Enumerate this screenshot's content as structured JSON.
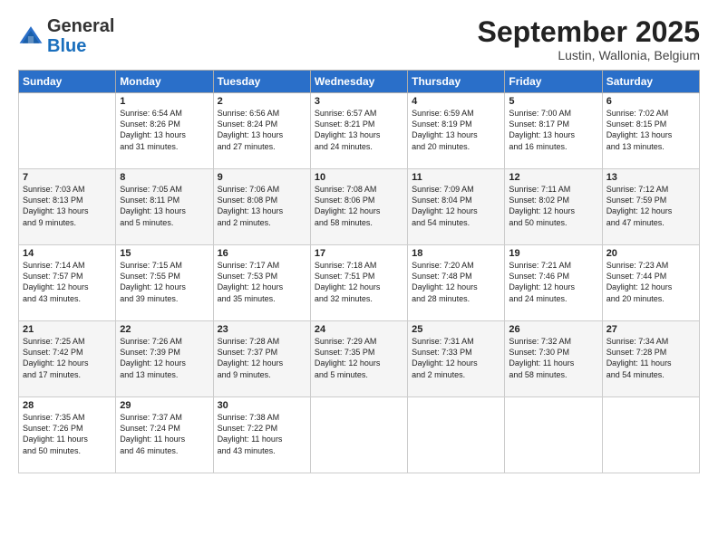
{
  "header": {
    "logo": {
      "general": "General",
      "blue": "Blue"
    },
    "month_title": "September 2025",
    "location": "Lustin, Wallonia, Belgium"
  },
  "days_of_week": [
    "Sunday",
    "Monday",
    "Tuesday",
    "Wednesday",
    "Thursday",
    "Friday",
    "Saturday"
  ],
  "weeks": [
    [
      {
        "day": "",
        "info": ""
      },
      {
        "day": "1",
        "info": "Sunrise: 6:54 AM\nSunset: 8:26 PM\nDaylight: 13 hours\nand 31 minutes."
      },
      {
        "day": "2",
        "info": "Sunrise: 6:56 AM\nSunset: 8:24 PM\nDaylight: 13 hours\nand 27 minutes."
      },
      {
        "day": "3",
        "info": "Sunrise: 6:57 AM\nSunset: 8:21 PM\nDaylight: 13 hours\nand 24 minutes."
      },
      {
        "day": "4",
        "info": "Sunrise: 6:59 AM\nSunset: 8:19 PM\nDaylight: 13 hours\nand 20 minutes."
      },
      {
        "day": "5",
        "info": "Sunrise: 7:00 AM\nSunset: 8:17 PM\nDaylight: 13 hours\nand 16 minutes."
      },
      {
        "day": "6",
        "info": "Sunrise: 7:02 AM\nSunset: 8:15 PM\nDaylight: 13 hours\nand 13 minutes."
      }
    ],
    [
      {
        "day": "7",
        "info": "Sunrise: 7:03 AM\nSunset: 8:13 PM\nDaylight: 13 hours\nand 9 minutes."
      },
      {
        "day": "8",
        "info": "Sunrise: 7:05 AM\nSunset: 8:11 PM\nDaylight: 13 hours\nand 5 minutes."
      },
      {
        "day": "9",
        "info": "Sunrise: 7:06 AM\nSunset: 8:08 PM\nDaylight: 13 hours\nand 2 minutes."
      },
      {
        "day": "10",
        "info": "Sunrise: 7:08 AM\nSunset: 8:06 PM\nDaylight: 12 hours\nand 58 minutes."
      },
      {
        "day": "11",
        "info": "Sunrise: 7:09 AM\nSunset: 8:04 PM\nDaylight: 12 hours\nand 54 minutes."
      },
      {
        "day": "12",
        "info": "Sunrise: 7:11 AM\nSunset: 8:02 PM\nDaylight: 12 hours\nand 50 minutes."
      },
      {
        "day": "13",
        "info": "Sunrise: 7:12 AM\nSunset: 7:59 PM\nDaylight: 12 hours\nand 47 minutes."
      }
    ],
    [
      {
        "day": "14",
        "info": "Sunrise: 7:14 AM\nSunset: 7:57 PM\nDaylight: 12 hours\nand 43 minutes."
      },
      {
        "day": "15",
        "info": "Sunrise: 7:15 AM\nSunset: 7:55 PM\nDaylight: 12 hours\nand 39 minutes."
      },
      {
        "day": "16",
        "info": "Sunrise: 7:17 AM\nSunset: 7:53 PM\nDaylight: 12 hours\nand 35 minutes."
      },
      {
        "day": "17",
        "info": "Sunrise: 7:18 AM\nSunset: 7:51 PM\nDaylight: 12 hours\nand 32 minutes."
      },
      {
        "day": "18",
        "info": "Sunrise: 7:20 AM\nSunset: 7:48 PM\nDaylight: 12 hours\nand 28 minutes."
      },
      {
        "day": "19",
        "info": "Sunrise: 7:21 AM\nSunset: 7:46 PM\nDaylight: 12 hours\nand 24 minutes."
      },
      {
        "day": "20",
        "info": "Sunrise: 7:23 AM\nSunset: 7:44 PM\nDaylight: 12 hours\nand 20 minutes."
      }
    ],
    [
      {
        "day": "21",
        "info": "Sunrise: 7:25 AM\nSunset: 7:42 PM\nDaylight: 12 hours\nand 17 minutes."
      },
      {
        "day": "22",
        "info": "Sunrise: 7:26 AM\nSunset: 7:39 PM\nDaylight: 12 hours\nand 13 minutes."
      },
      {
        "day": "23",
        "info": "Sunrise: 7:28 AM\nSunset: 7:37 PM\nDaylight: 12 hours\nand 9 minutes."
      },
      {
        "day": "24",
        "info": "Sunrise: 7:29 AM\nSunset: 7:35 PM\nDaylight: 12 hours\nand 5 minutes."
      },
      {
        "day": "25",
        "info": "Sunrise: 7:31 AM\nSunset: 7:33 PM\nDaylight: 12 hours\nand 2 minutes."
      },
      {
        "day": "26",
        "info": "Sunrise: 7:32 AM\nSunset: 7:30 PM\nDaylight: 11 hours\nand 58 minutes."
      },
      {
        "day": "27",
        "info": "Sunrise: 7:34 AM\nSunset: 7:28 PM\nDaylight: 11 hours\nand 54 minutes."
      }
    ],
    [
      {
        "day": "28",
        "info": "Sunrise: 7:35 AM\nSunset: 7:26 PM\nDaylight: 11 hours\nand 50 minutes."
      },
      {
        "day": "29",
        "info": "Sunrise: 7:37 AM\nSunset: 7:24 PM\nDaylight: 11 hours\nand 46 minutes."
      },
      {
        "day": "30",
        "info": "Sunrise: 7:38 AM\nSunset: 7:22 PM\nDaylight: 11 hours\nand 43 minutes."
      },
      {
        "day": "",
        "info": ""
      },
      {
        "day": "",
        "info": ""
      },
      {
        "day": "",
        "info": ""
      },
      {
        "day": "",
        "info": ""
      }
    ]
  ]
}
